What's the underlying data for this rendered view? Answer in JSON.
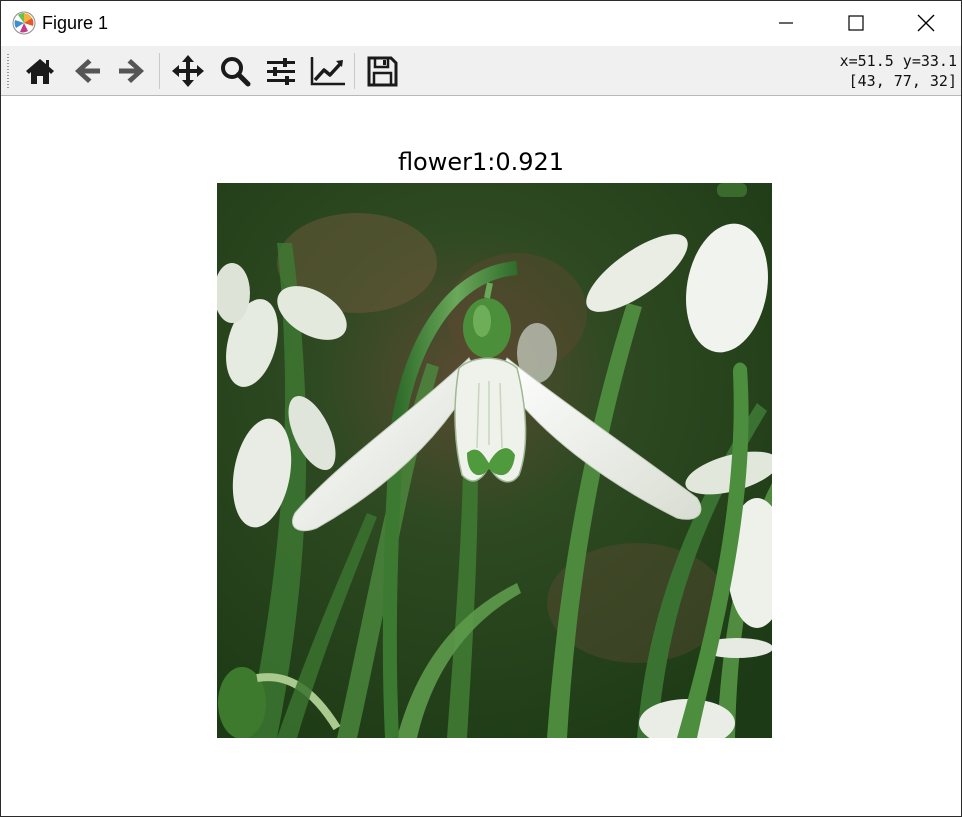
{
  "window": {
    "title": "Figure 1",
    "app_icon": "matplotlib-logo-icon",
    "controls": [
      "minimize-icon",
      "maximize-icon",
      "close-icon"
    ]
  },
  "toolbar": {
    "buttons": [
      "home-icon",
      "back-arrow-icon",
      "forward-arrow-icon",
      "pan-move-icon",
      "zoom-magnifier-icon",
      "configure-subplots-icon",
      "edit-axis-curve-icon",
      "save-floppy-icon"
    ],
    "coords_line1": "x=51.5 y=33.1",
    "coords_line2": "[43, 77, 32]"
  },
  "figure": {
    "title": "flower1:0.921",
    "image_subject": "white snowdrop flower with green stems"
  },
  "colors": {
    "toolbar_bg": "#f0f0f0",
    "icon": "#1a1a1a",
    "petal": "#f2f4f0",
    "leaf": "#2f6b2a"
  }
}
